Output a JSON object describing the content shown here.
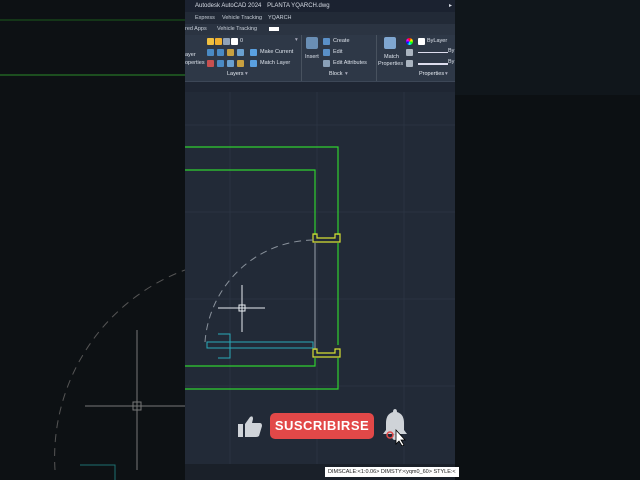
{
  "app": {
    "title": "Autodesk AutoCAD 2024",
    "file": "PLANTA YQARCH.dwg"
  },
  "menu_tabs": [
    "Express",
    "Vehicle Tracking",
    "YQARCH"
  ],
  "sub_tabs": [
    "red Apps",
    "Vehicle Tracking"
  ],
  "ribbon": {
    "layer_panel": {
      "layer_label": "ayer",
      "properties_label": "operties",
      "layer_value": "0",
      "make_current": "Make Current",
      "match_layer": "Match Layer",
      "panel_title": "Layers"
    },
    "block_panel": {
      "insert": "Insert",
      "create": "Create",
      "edit": "Edit",
      "edit_attributes": "Edit Attributes",
      "panel_title": "Block"
    },
    "properties_panel": {
      "match": "Match",
      "properties": "Properties",
      "bylayer": "ByLayer",
      "by1": "By",
      "by2": "By",
      "panel_title": "Properties"
    }
  },
  "status": {
    "text": "DIMSCALE:<1:0.06> DIMSTY:<yqm0_60> STYLE:<"
  },
  "overlay": {
    "subscribe_label": "SUSCRIBIRSE",
    "like_icon": "thumbs-up-icon",
    "bell_icon": "bell-icon"
  },
  "colors": {
    "wall": "#2fd12f",
    "door": "#d7e032",
    "cyan": "#2aa9b8",
    "subscribe": "#e24848"
  }
}
